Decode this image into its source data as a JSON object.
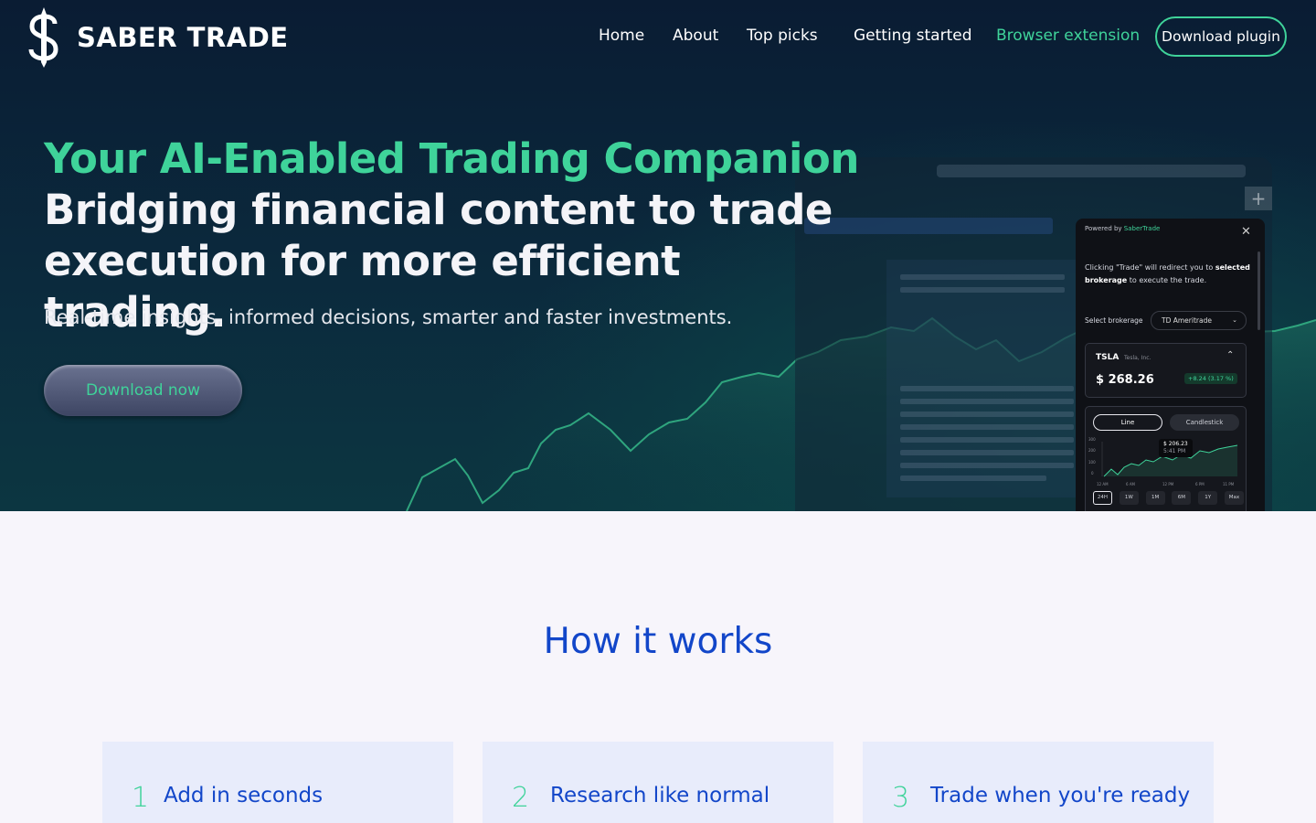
{
  "brand": {
    "name": "SABER TRADE"
  },
  "nav": {
    "links": [
      "Home",
      "About",
      "Top picks",
      "Getting started",
      "Browser extension"
    ],
    "cta": "Download plugin",
    "accent_color": "#3fd39a"
  },
  "hero": {
    "headline_accent": "Your AI-Enabled Trading Companion",
    "headline": "Bridging financial content to trade execution for more efficient trading.",
    "subtitle": "Real-time insights, informed decisions, smarter and faster investments.",
    "cta": "Download now"
  },
  "plugin": {
    "powered_prefix": "Powered by ",
    "powered_brand": "SaberTrade",
    "info_part1": "Clicking \"Trade\" will redirect you to ",
    "info_bold": "selected brokerage",
    "info_part2": " to execute the trade.",
    "brokerage_label": "Select brokerage",
    "brokerage_value": "TD Ameritrade",
    "stock": {
      "symbol": "TSLA",
      "name": "Tesla, Inc.",
      "price": "$ 268.26",
      "change": "+8.24 (3.17 %)"
    },
    "chart_tabs": [
      "Line",
      "Candlestick"
    ],
    "tooltip_price": "$ 206.23",
    "tooltip_time": "5:41 PM",
    "y_ticks": [
      "300",
      "200",
      "100",
      "0"
    ],
    "x_ticks": [
      "12 AM",
      "6 AM",
      "12 PM",
      "6 PM",
      "11 PM"
    ],
    "ranges": [
      "24H",
      "1W",
      "1M",
      "6M",
      "1Y",
      "Max"
    ],
    "selected_range": "24H"
  },
  "how": {
    "title": "How it works",
    "steps": [
      {
        "num": "1",
        "text": "Add in seconds"
      },
      {
        "num": "2",
        "text": "Research like normal"
      },
      {
        "num": "3",
        "text": "Trade when you're ready"
      }
    ]
  }
}
